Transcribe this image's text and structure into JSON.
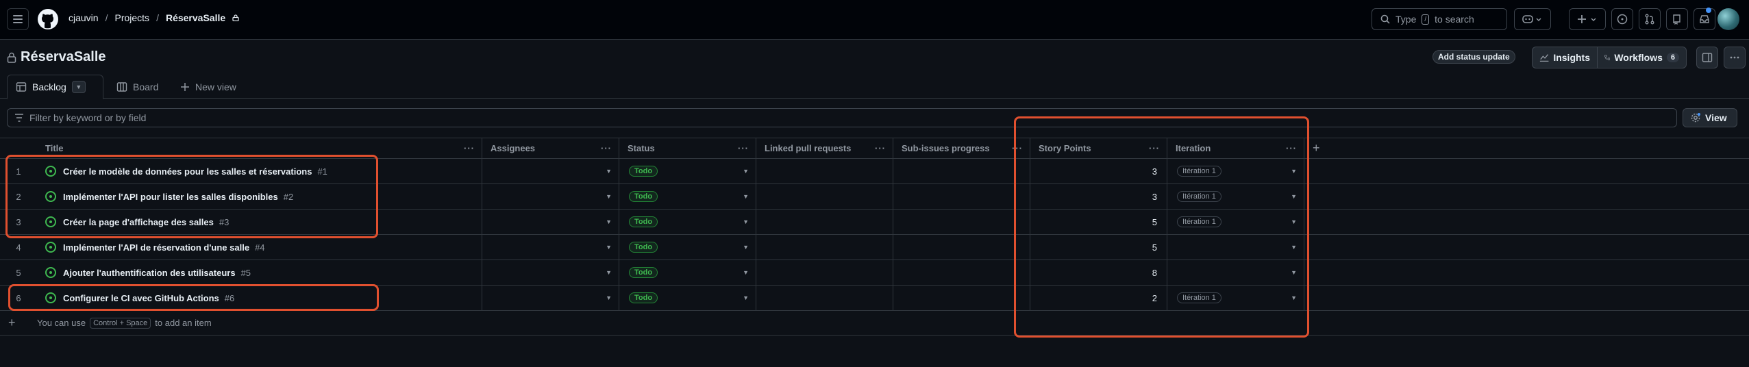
{
  "topbar": {
    "owner": "cjauvin",
    "separator": "/",
    "section": "Projects",
    "project": "RéservaSalle",
    "search_prefix": "Type",
    "search_key": "/",
    "search_suffix": "to search"
  },
  "project_header": {
    "title": "RéservaSalle",
    "status_button": "Add status update",
    "insights_label": "Insights",
    "workflows_label": "Workflows",
    "workflows_count": "6"
  },
  "tabs": [
    {
      "label": "Backlog",
      "icon": "table-icon",
      "active": true
    },
    {
      "label": "Board",
      "icon": "board-icon",
      "active": false
    },
    {
      "label": "New view",
      "icon": "plus-icon",
      "active": false
    }
  ],
  "filter": {
    "placeholder": "Filter by keyword or by field",
    "view_label": "View"
  },
  "columns": [
    "Title",
    "Assignees",
    "Status",
    "Linked pull requests",
    "Sub-issues progress",
    "Story Points",
    "Iteration"
  ],
  "rows": [
    {
      "num": "1",
      "title": "Créer le modèle de données pour les salles et réservations",
      "issue": "#1",
      "status": "Todo",
      "points": "3",
      "iteration": "Itération 1"
    },
    {
      "num": "2",
      "title": "Implémenter l'API pour lister les salles disponibles",
      "issue": "#2",
      "status": "Todo",
      "points": "3",
      "iteration": "Itération 1"
    },
    {
      "num": "3",
      "title": "Créer la page d'affichage des salles",
      "issue": "#3",
      "status": "Todo",
      "points": "5",
      "iteration": "Itération 1"
    },
    {
      "num": "4",
      "title": "Implémenter l'API de réservation d'une salle",
      "issue": "#4",
      "status": "Todo",
      "points": "5",
      "iteration": ""
    },
    {
      "num": "5",
      "title": "Ajouter l'authentification des utilisateurs",
      "issue": "#5",
      "status": "Todo",
      "points": "8",
      "iteration": ""
    },
    {
      "num": "6",
      "title": "Configurer le CI avec GitHub Actions",
      "issue": "#6",
      "status": "Todo",
      "points": "2",
      "iteration": "Itération 1"
    }
  ],
  "add_item": {
    "prefix": "You can use",
    "shortcut": "Control + Space",
    "suffix": "to add an item"
  },
  "colors": {
    "background": "#0d1117",
    "status_green": "#3fb950",
    "annotation": "#e0502f"
  }
}
